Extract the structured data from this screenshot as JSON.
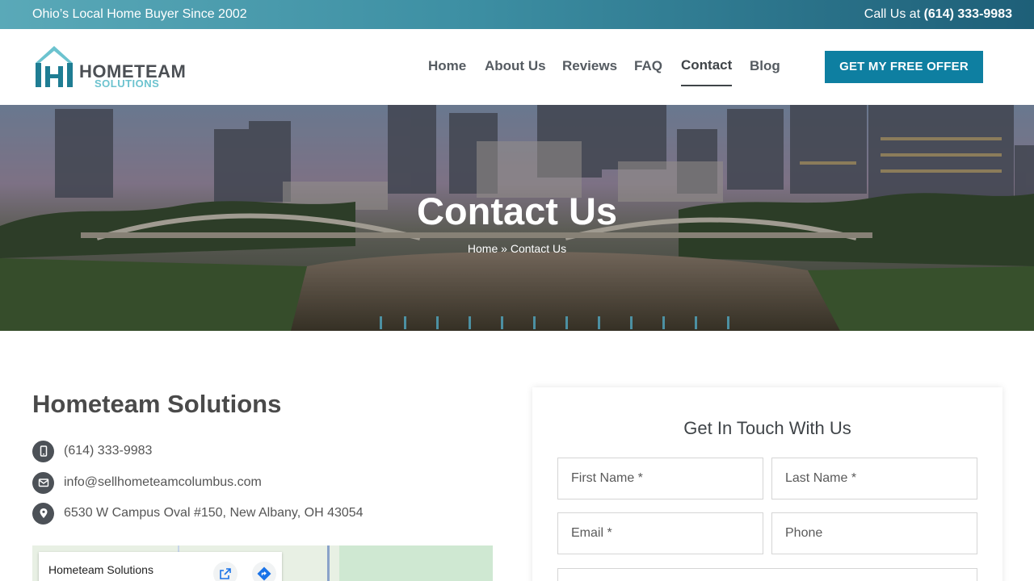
{
  "topbar": {
    "tagline": "Ohio’s Local Home Buyer Since 2002",
    "call_prefix": "Call Us at ",
    "phone": "(614) 333-9983"
  },
  "logo": {
    "word1": "HOMETEAM",
    "word2": "SOLUTIONS",
    "colors": {
      "primary": "#1f7d93",
      "roof": "#6cc3cf",
      "text": "#4b4f54"
    }
  },
  "nav": {
    "items": [
      {
        "label": "Home"
      },
      {
        "label": "About Us"
      },
      {
        "label": "Reviews"
      },
      {
        "label": "FAQ"
      },
      {
        "label": "Contact",
        "active": true
      },
      {
        "label": "Blog"
      }
    ],
    "cta_label": "GET MY FREE OFFER"
  },
  "hero": {
    "title": "Contact Us",
    "breadcrumb": {
      "home": "Home",
      "separator": "»",
      "current": "Contact Us"
    }
  },
  "contact": {
    "company": "Hometeam Solutions",
    "phone": "(614) 333-9983",
    "email": "info@sellhometeamcolumbus.com",
    "address": "6530 W Campus Oval #150, New Albany, OH 43054",
    "icons": [
      "mobile-phone-icon",
      "envelope-icon",
      "map-pin-icon"
    ]
  },
  "map": {
    "place_name": "Hometeam Solutions",
    "icons": [
      "open-in-new-icon",
      "directions-icon"
    ]
  },
  "form": {
    "title": "Get In Touch With Us",
    "fields": {
      "first_name": "First Name *",
      "last_name": "Last Name *",
      "email": "Email *",
      "phone": "Phone"
    }
  },
  "colors": {
    "accent": "#0e7fa1",
    "topbar_start": "#5aa9b8",
    "topbar_end": "#1e5f78",
    "text_dark": "#4a4a4a",
    "icon_bg": "#4c5157"
  }
}
